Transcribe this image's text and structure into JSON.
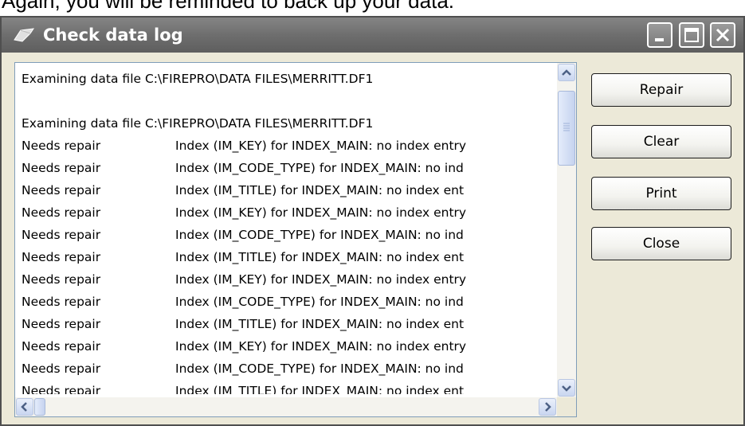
{
  "background_text": "Again, you will be reminded to back up your data.",
  "window": {
    "title": "Check data log",
    "controls": {
      "minimize_icon": "minimize-icon",
      "maximize_icon": "maximize-icon",
      "close_icon": "close-icon"
    }
  },
  "log": {
    "lines": [
      {
        "status": "Examining data file C:\\FIREPRO\\DATA FILES\\MERRITT.DF1",
        "detail": ""
      },
      {
        "status": "",
        "detail": ""
      },
      {
        "status": "Examining data file C:\\FIREPRO\\DATA FILES\\MERRITT.DF1",
        "detail": ""
      },
      {
        "status": "Needs repair",
        "detail": "Index (IM_KEY) for INDEX_MAIN: no index entry"
      },
      {
        "status": "Needs repair",
        "detail": "Index (IM_CODE_TYPE) for INDEX_MAIN: no ind"
      },
      {
        "status": "Needs repair",
        "detail": "Index (IM_TITLE) for INDEX_MAIN: no index ent"
      },
      {
        "status": "Needs repair",
        "detail": "Index (IM_KEY) for INDEX_MAIN: no index entry"
      },
      {
        "status": "Needs repair",
        "detail": "Index (IM_CODE_TYPE) for INDEX_MAIN: no ind"
      },
      {
        "status": "Needs repair",
        "detail": "Index (IM_TITLE) for INDEX_MAIN: no index ent"
      },
      {
        "status": "Needs repair",
        "detail": "Index (IM_KEY) for INDEX_MAIN: no index entry"
      },
      {
        "status": "Needs repair",
        "detail": "Index (IM_CODE_TYPE) for INDEX_MAIN: no ind"
      },
      {
        "status": "Needs repair",
        "detail": "Index (IM_TITLE) for INDEX_MAIN: no index ent"
      },
      {
        "status": "Needs repair",
        "detail": "Index (IM_KEY) for INDEX_MAIN: no index entry"
      },
      {
        "status": "Needs repair",
        "detail": "Index (IM_CODE_TYPE) for INDEX_MAIN: no ind"
      },
      {
        "status": "Needs repair",
        "detail": "Index (IM_TITLE) for INDEX_MAIN: no index ent"
      }
    ]
  },
  "buttons": {
    "repair": "Repair",
    "clear": "Clear",
    "print": "Print",
    "close": "Close"
  },
  "colors": {
    "titlebar": "#6e6e6e",
    "dialog_bg": "#ece9d8",
    "list_bg": "#ffffff"
  }
}
